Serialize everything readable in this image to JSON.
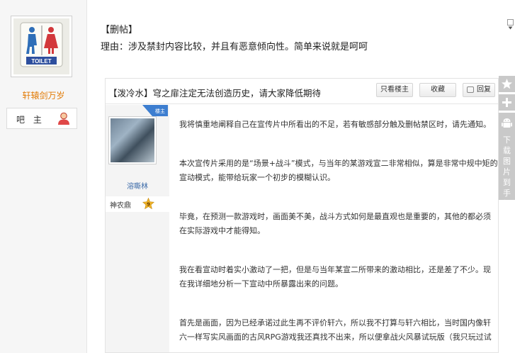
{
  "author": {
    "username": "轩辕剑万岁",
    "role": "吧 主",
    "avatar_text": "TOILET"
  },
  "notice": {
    "title": "【删帖】",
    "reason": "理由：涉及禁封内容比较，并且有恶意倾向性。简单来说就是呵呵"
  },
  "embedded_thread": {
    "title": "【泼冷水】穹之扉注定无法创造历史，请大家降低期待",
    "buttons": {
      "only_op": "只看楼主",
      "favorite": "收藏",
      "reply": "回复"
    },
    "poster": {
      "badge": "楼主",
      "name": "溶嘶林",
      "level_title": "神农鼎",
      "level_num": "9"
    },
    "paragraphs": [
      "我将慎重地阐释自己在宣传片中所看出的不足，若有敏感部分触及删帖禁区时，请先通知。",
      "本次宣传片采用的是“场景+战斗”模式，与当年的某游戏宣二非常相似，算是非常中规中矩的宣动模式，能带给玩家一个初步的模糊认识。",
      "毕竟，在预测一款游戏时，画面美不美，战斗方式如何是最直观也是重要的，其他的都必须在实际游戏中才能得知。",
      "我在看宣动时着实小激动了一把，但是与当年某宣二所带来的激动相比，还是差了不少。现在我详细地分析一下宣动中所暴露出来的问题。",
      "首先是画面，因为已经承诺过此生再不评价轩六，所以我不打算与轩六相比，当时国内像轩六一样写实风画面的古风RPG游戏我还真找不出来，所以便拿战火风暴试玩版（我只玩过试"
    ]
  },
  "sidebar": {
    "download_text": "下载图片到手机"
  }
}
